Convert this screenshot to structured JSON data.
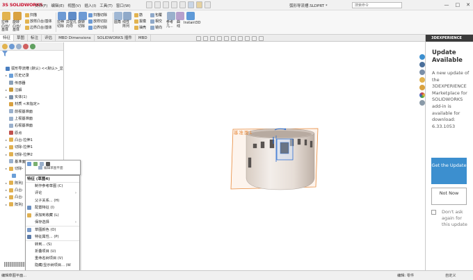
{
  "app": {
    "logo_ds": "3S",
    "logo_text": "SOLIDWORKS",
    "document_title": "弧形导流槽.SLDPRT *",
    "search_placeholder": "搜索命令"
  },
  "menu": [
    "文件(F)",
    "编辑(E)",
    "视图(V)",
    "插入(I)",
    "工具(T)",
    "窗口(W)"
  ],
  "window_buttons": [
    "—",
    "□",
    "✕"
  ],
  "ribbon": {
    "extrude_boss": "拉伸\n凸台/\n基体",
    "revolve_boss": "旋转\n凸台/\n基体",
    "sweep": "扫描",
    "loft": "放样凸台/基体",
    "boundary_boss": "边界凸台/基体",
    "extrude_cut": "拉伸\n切除",
    "hole_wizard": "异型孔\n向导",
    "revolve_cut": "旋转\n切除",
    "sweep_cut": "扫描切除",
    "loft_cut": "放样切割",
    "boundary_cut": "边界切除",
    "fillet": "圆角",
    "linear_pattern": "线性\n阵列",
    "rib": "筋",
    "wrap": "包覆",
    "draft": "拔模",
    "intersect": "相交",
    "shell": "抽壳",
    "mirror": "镜向",
    "ref_geom": "参考\n几...",
    "curves": "曲\n线",
    "instant3d": "Instant3D"
  },
  "tabs": [
    "特征",
    "草图",
    "标注",
    "评估",
    "MBD Dimensions",
    "SOLIDWORKS 插件",
    "MBD"
  ],
  "tree": [
    {
      "label": "弧形导流槽 (默认) <<默认>_显",
      "indent": 3,
      "exp": "",
      "color": "#4a7fc0"
    },
    {
      "label": "历史记录",
      "indent": 8,
      "exp": "▸",
      "color": "#6a9fd8"
    },
    {
      "label": "传感器",
      "indent": 8,
      "exp": "",
      "color": "#8aa0b8"
    },
    {
      "label": "注解",
      "indent": 8,
      "exp": "▸",
      "color": "#c89a3a"
    },
    {
      "label": "实体(1)",
      "indent": 8,
      "exp": "▸",
      "color": "#7a8fa8"
    },
    {
      "label": "材质 <未指定>",
      "indent": 8,
      "exp": "",
      "color": "#d8a040"
    },
    {
      "label": "前视基准面",
      "indent": 8,
      "exp": "",
      "color": "#9ab0cc"
    },
    {
      "label": "上视基准面",
      "indent": 8,
      "exp": "",
      "color": "#9ab0cc"
    },
    {
      "label": "右视基准面",
      "indent": 8,
      "exp": "",
      "color": "#9ab0cc"
    },
    {
      "label": "原点",
      "indent": 8,
      "exp": "",
      "color": "#c0504d"
    },
    {
      "label": "凸台-拉伸1",
      "indent": 8,
      "exp": "▸",
      "color": "#e0b050"
    },
    {
      "label": "切除-拉伸1",
      "indent": 8,
      "exp": "▸",
      "color": "#e0b050"
    },
    {
      "label": "切除-拉伸2",
      "indent": 8,
      "exp": "▸",
      "color": "#e0b050"
    },
    {
      "label": "基准面",
      "indent": 8,
      "exp": "",
      "color": "#9ab0cc"
    },
    {
      "label": "切除-",
      "indent": 8,
      "exp": "▸",
      "color": "#e0b050"
    },
    {
      "label": "",
      "indent": 12,
      "exp": "",
      "color": "#6a9fd8"
    },
    {
      "label": "阵列(",
      "indent": 8,
      "exp": "▸",
      "color": "#e0b050"
    },
    {
      "label": "凸台-",
      "indent": 8,
      "exp": "▸",
      "color": "#e0b050"
    },
    {
      "label": "凸台-",
      "indent": 8,
      "exp": "▸",
      "color": "#e0b050"
    },
    {
      "label": "阵列(",
      "indent": 8,
      "exp": "▸",
      "color": "#e0b050"
    }
  ],
  "context_menu": {
    "header": "特征 (草图4)",
    "mini_hint": "编辑草图平面",
    "items": [
      {
        "label": "制作参考草图 (C)",
        "icon": "",
        "sep": false,
        "arrow": false
      },
      {
        "label": "评论",
        "icon": "",
        "sep": false,
        "arrow": true
      },
      {
        "label": "父子关系... (H)",
        "icon": "",
        "sep": false,
        "arrow": false
      },
      {
        "label": "配置特征 (I)",
        "icon": "#6b8fc0",
        "sep": false,
        "arrow": false
      },
      {
        "label": "添加到收藏 (L)",
        "icon": "#e0b050",
        "sep": false,
        "arrow": false
      },
      {
        "label": "保存选择",
        "icon": "",
        "sep": false,
        "arrow": true
      },
      {
        "label": "草图颜色 (O)",
        "icon": "#7a9ac8",
        "sep": true,
        "arrow": false
      },
      {
        "label": "特征属性... (P)",
        "icon": "#5a7aa8",
        "sep": false,
        "arrow": false
      },
      {
        "label": "转到... (S)",
        "icon": "",
        "sep": true,
        "arrow": false
      },
      {
        "label": "折叠项目 (U)",
        "icon": "",
        "sep": false,
        "arrow": false
      },
      {
        "label": "重命名树项目 (V)",
        "icon": "",
        "sep": false,
        "arrow": false
      },
      {
        "label": "隐藏/显示树项目... (W",
        "icon": "",
        "sep": false,
        "arrow": false
      }
    ],
    "more": "⌄"
  },
  "viewport": {
    "sketch_label": "基准面1"
  },
  "taskpane": {
    "header": "3DEXPERIENCE",
    "title": "Update Available",
    "message": "A new update of the 3DEXPERIENCE Marketplace for SOLIDWORKS add-in is available for download: 6.33.1053",
    "get_update": "Get the Update",
    "not_now": "Not Now",
    "dont_ask": "Don't ask again for this update"
  },
  "status": {
    "left": "编辑草图平面...",
    "mid": "编辑: 零件",
    "right": "自定义"
  },
  "colors": {
    "accent": "#3c8fcf",
    "sketch_orange": "#e8893a",
    "part_body": "#e9e2dc"
  }
}
